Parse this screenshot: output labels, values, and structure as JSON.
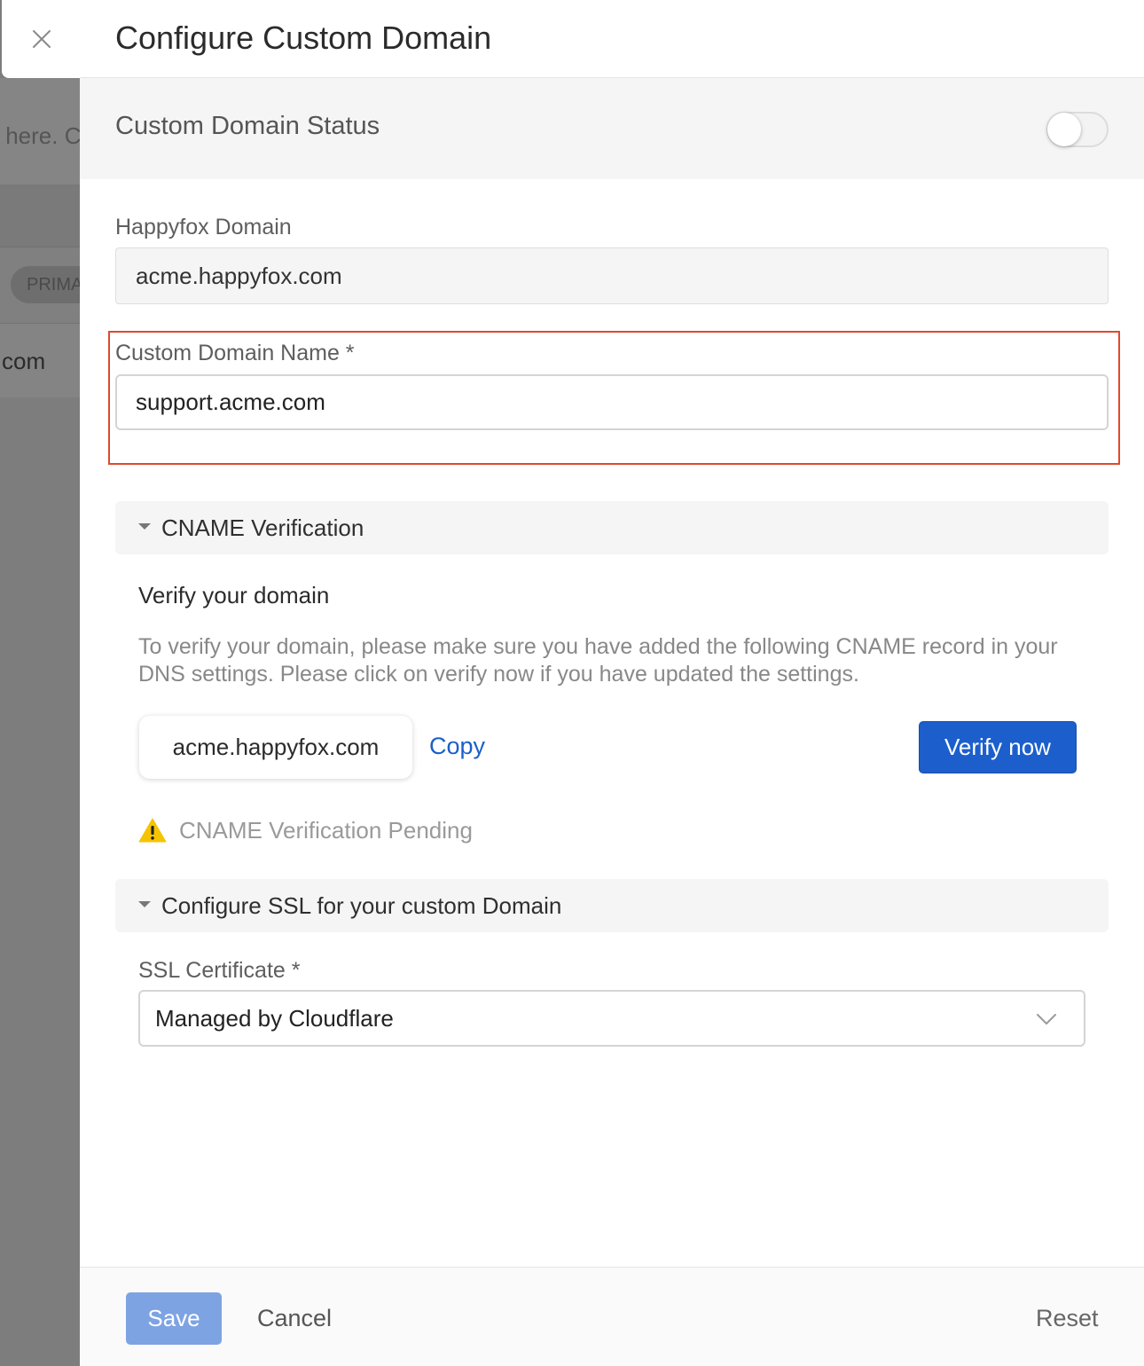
{
  "background": {
    "text_fragment": "s here. C",
    "pill": "PRIMA",
    "row_text": "com"
  },
  "drawer": {
    "title": "Configure Custom Domain"
  },
  "status": {
    "label": "Custom Domain Status",
    "enabled": false
  },
  "happyfox_domain": {
    "label": "Happyfox Domain",
    "value": "acme.happyfox.com"
  },
  "custom_domain": {
    "label": "Custom Domain Name *",
    "value": "support.acme.com"
  },
  "cname_section": {
    "title": "CNAME Verification",
    "heading": "Verify your domain",
    "description": "To verify your domain, please make sure you have added the following CNAME record in your DNS settings. Please click on verify now if you have updated the settings.",
    "record": "acme.happyfox.com",
    "copy_label": "Copy",
    "verify_label": "Verify now",
    "status_text": "CNAME Verification Pending",
    "status_icon": "warning-icon"
  },
  "ssl_section": {
    "title": "Configure SSL for your custom Domain",
    "certificate_label": "SSL Certificate *",
    "certificate_value": "Managed by Cloudflare"
  },
  "footer": {
    "save_label": "Save",
    "cancel_label": "Cancel",
    "reset_label": "Reset"
  },
  "colors": {
    "primary": "#1c5fcc",
    "highlight": "#e0492d",
    "warning": "#f5c400"
  }
}
